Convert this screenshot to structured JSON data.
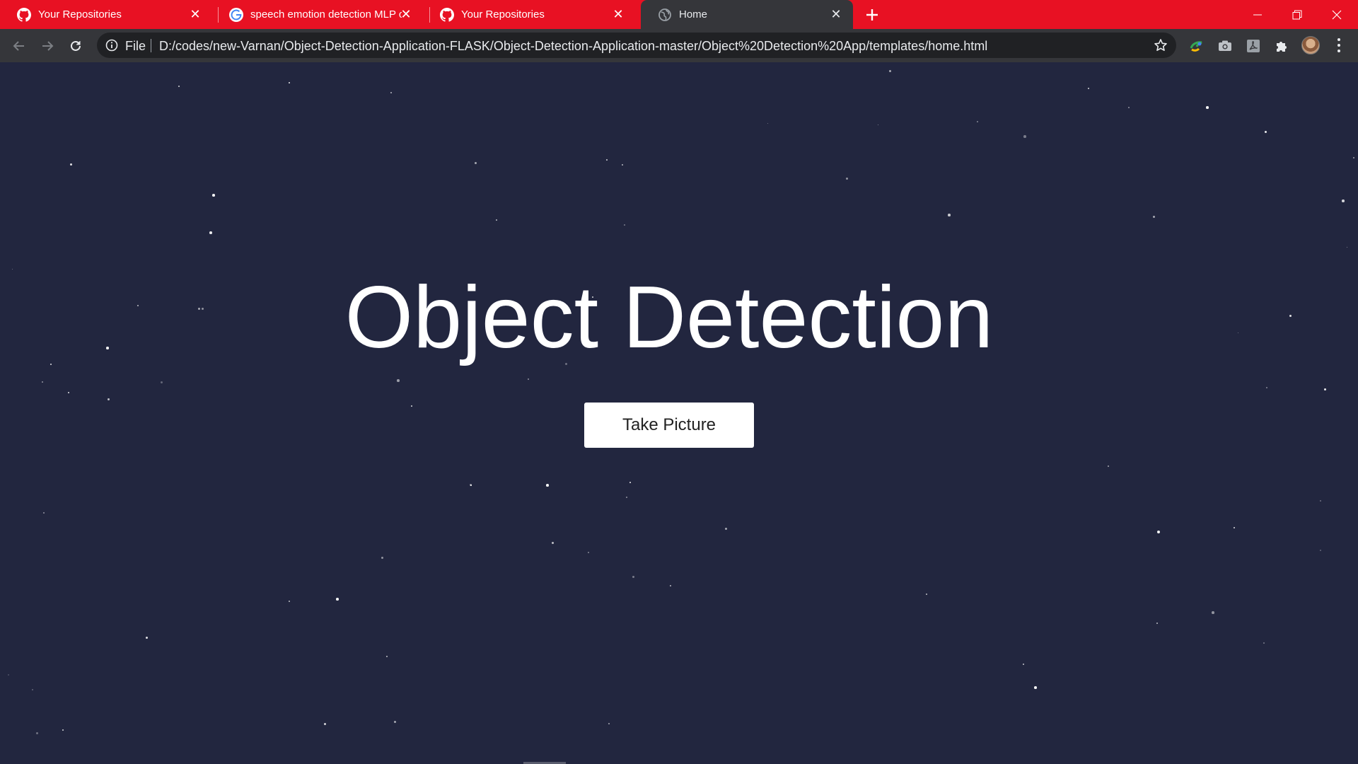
{
  "browser": {
    "tabs": [
      {
        "title": "Your Repositories",
        "favicon": "github-icon",
        "active": false
      },
      {
        "title": "speech emotion detection MLP c",
        "favicon": "google-icon",
        "active": false
      },
      {
        "title": "Your Repositories",
        "favicon": "github-icon",
        "active": false
      },
      {
        "title": "Home",
        "favicon": "globe-icon",
        "active": true
      }
    ],
    "omnibox": {
      "scheme_label": "File",
      "url": "D:/codes/new-Varnan/Object-Detection-Application-FLASK/Object-Detection-Application-master/Object%20Detection%20App/templates/home.html"
    },
    "colors": {
      "tabstrip": "#e81123",
      "toolbar": "#35363a",
      "omnibox": "#202124"
    }
  },
  "page": {
    "heading": "Object Detection",
    "button_label": "Take Picture",
    "background_color": "#22263f"
  }
}
